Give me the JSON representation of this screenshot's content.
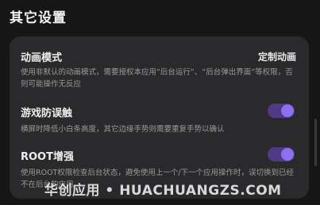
{
  "section": {
    "title": "其它设置"
  },
  "settings": [
    {
      "title": "动画模式",
      "value": "定制动画",
      "description": "使用非默认的动画模式，需要授权本应用“后台运行”、“后台弹出界面”等权限，否则可能操作无反应"
    },
    {
      "title": "游戏防误触",
      "toggle": true,
      "description": "横屏时降低小白条高度，其它边缘手势则需要重复手势以确认"
    },
    {
      "title": "ROOT增强",
      "toggle": true,
      "description": "使用ROOT权限检查后台状态，避免使用上一个/下一个应用操作时，误切换到已经不在后台的应用"
    }
  ],
  "watermark": {
    "text": "华创应用 • HUACHUANGZS.COM"
  },
  "colors": {
    "accent": "#8f6ff0",
    "track": "#4e3a86",
    "card": "#2a2a2c",
    "background": "#161616"
  }
}
